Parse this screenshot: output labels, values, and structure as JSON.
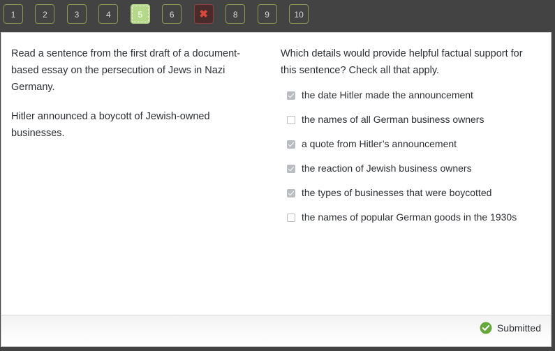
{
  "nav": {
    "buttons": [
      {
        "label": "1",
        "state": "normal"
      },
      {
        "label": "2",
        "state": "normal"
      },
      {
        "label": "3",
        "state": "normal"
      },
      {
        "label": "4",
        "state": "normal"
      },
      {
        "label": "5",
        "state": "current"
      },
      {
        "label": "6",
        "state": "normal"
      },
      {
        "label": "✖",
        "state": "wrong"
      },
      {
        "label": "8",
        "state": "normal"
      },
      {
        "label": "9",
        "state": "normal"
      },
      {
        "label": "10",
        "state": "normal"
      }
    ],
    "colors": {
      "bar_background": "#434343",
      "button_border": "#8a9a55",
      "button_text": "#d8d8d8",
      "current_background": "#b5d88a",
      "wrong_background": "#4a2b2b",
      "wrong_border": "#8c4040",
      "wrong_glyph": "#d94a3d"
    }
  },
  "passage": {
    "paragraph_1": "Read a sentence from the first draft of a document-based essay on the persecution of Jews in Nazi Germany.",
    "paragraph_2": "Hitler announced a boycott of Jewish-owned businesses."
  },
  "question": {
    "prompt": "Which details would provide helpful factual support for this sentence? Check all that apply.",
    "options": [
      {
        "label": "the date Hitler made the announcement",
        "checked": true
      },
      {
        "label": "the names of all German business owners",
        "checked": false
      },
      {
        "label": "a quote from Hitler’s announcement",
        "checked": true
      },
      {
        "label": "the reaction of Jewish business owners",
        "checked": true
      },
      {
        "label": "the types of businesses that were boycotted",
        "checked": true
      },
      {
        "label": "the names of popular German goods in the 1930s",
        "checked": false
      }
    ]
  },
  "footer": {
    "status_label": "Submitted",
    "status_icon": "check-circle-icon",
    "status_color": "#64a83c"
  }
}
